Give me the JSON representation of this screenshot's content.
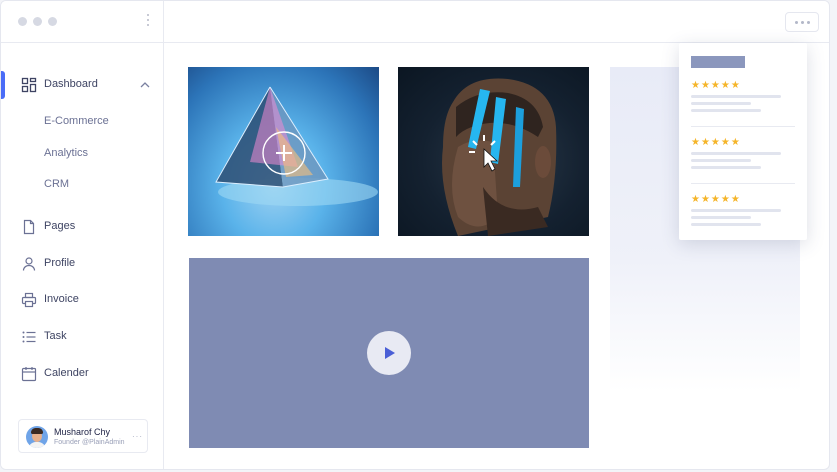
{
  "window": {
    "controls": [
      "red",
      "yellow",
      "green"
    ]
  },
  "sidebar": {
    "items": [
      {
        "label": "Dashboard",
        "icon": "grid-icon",
        "active": true,
        "expanded": true
      },
      {
        "label": "Pages",
        "icon": "file-icon"
      },
      {
        "label": "Profile",
        "icon": "user-icon"
      },
      {
        "label": "Invoice",
        "icon": "printer-icon"
      },
      {
        "label": "Task",
        "icon": "list-icon"
      },
      {
        "label": "Calender",
        "icon": "calendar-icon"
      }
    ],
    "subitems": [
      "E-Commerce",
      "Analytics",
      "CRM"
    ]
  },
  "user": {
    "name": "Musharof Chy",
    "role": "Founder @PlainAdmin"
  },
  "reviews": {
    "stars": [
      "★★★★★",
      "★★★★★",
      "★★★★★"
    ],
    "rating": 5
  },
  "colors": {
    "accent": "#4a6cf7",
    "star": "#f5b52a",
    "video_bg": "#7f8bb3"
  }
}
